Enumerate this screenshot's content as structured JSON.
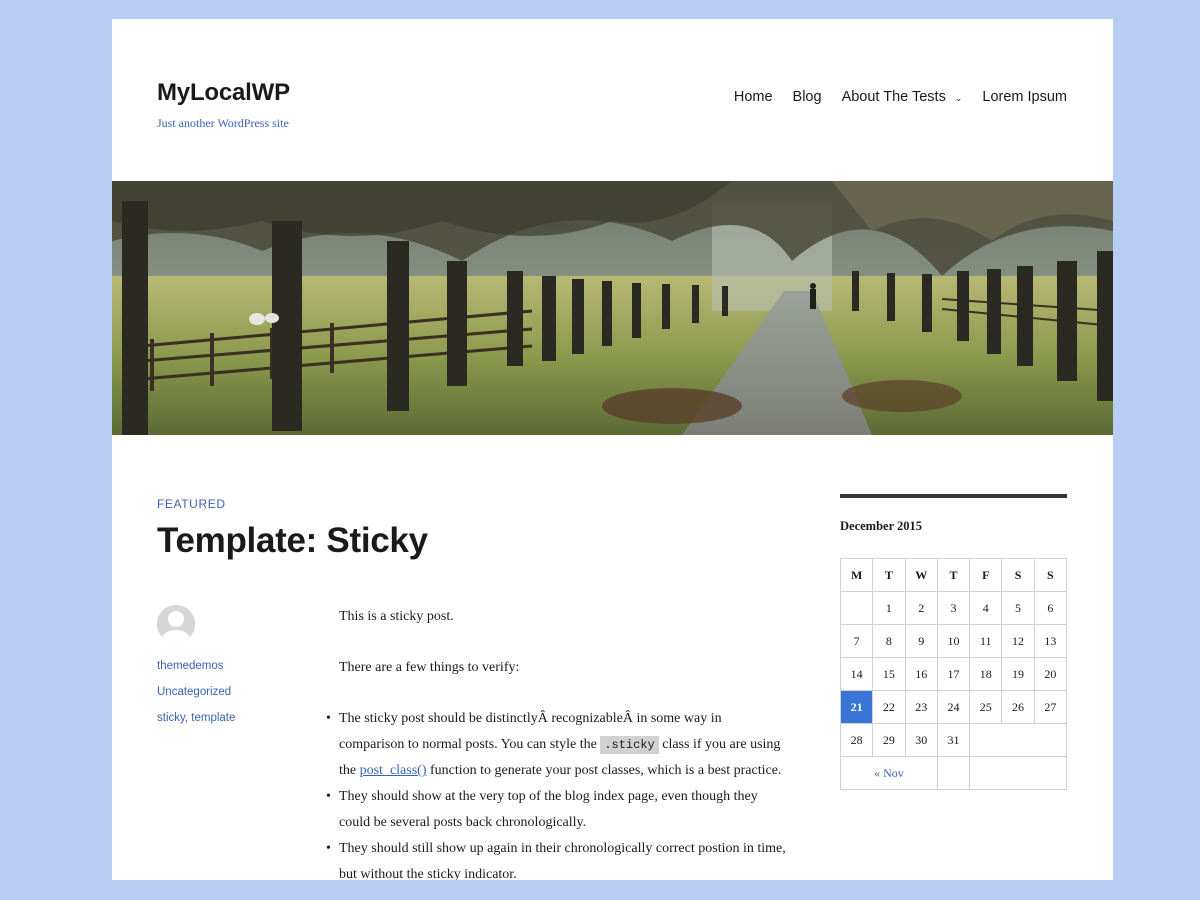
{
  "site": {
    "title": "MyLocalWP",
    "description": "Just another WordPress site"
  },
  "nav": {
    "items": [
      {
        "label": "Home"
      },
      {
        "label": "Blog"
      },
      {
        "label": "About The Tests",
        "has_submenu": true
      },
      {
        "label": "Lorem Ipsum"
      }
    ]
  },
  "post": {
    "category": "FEATURED",
    "title": "Template: Sticky",
    "author": "themedemos",
    "categories_meta": "Uncategorized",
    "tags": "sticky, template",
    "intro1": "This is a sticky post.",
    "intro2": "There are a few things to verify:",
    "li1_a": "The sticky post should be distinctlyÂ recognizableÂ in some way in comparison to normal posts. You can style the ",
    "li1_code": ".sticky",
    "li1_b": " class if you are using the ",
    "li1_link": "post_class()",
    "li1_c": " function to generate your post classes, which is a best practice.",
    "li2": "They should show at the very top of the blog index page, even though they could be several posts back chronologically.",
    "li3": "They should still show up again in their chronologically correct postion in time, but without the sticky indicator."
  },
  "calendar": {
    "caption": "December 2015",
    "weekdays": [
      "M",
      "T",
      "W",
      "T",
      "F",
      "S",
      "S"
    ],
    "weeks": [
      [
        "",
        "1",
        "2",
        "3",
        "4",
        "5",
        "6"
      ],
      [
        "7",
        "8",
        "9",
        "10",
        "11",
        "12",
        "13"
      ],
      [
        "14",
        "15",
        "16",
        "17",
        "18",
        "19",
        "20"
      ],
      [
        "21",
        "22",
        "23",
        "24",
        "25",
        "26",
        "27"
      ],
      [
        "28",
        "29",
        "30",
        "31",
        "",
        "",
        ""
      ]
    ],
    "today": "21",
    "prev_label": "« Nov",
    "accent": "#3875d7"
  },
  "colors": {
    "background": "#b7cdf3",
    "link": "#3a64b4"
  }
}
